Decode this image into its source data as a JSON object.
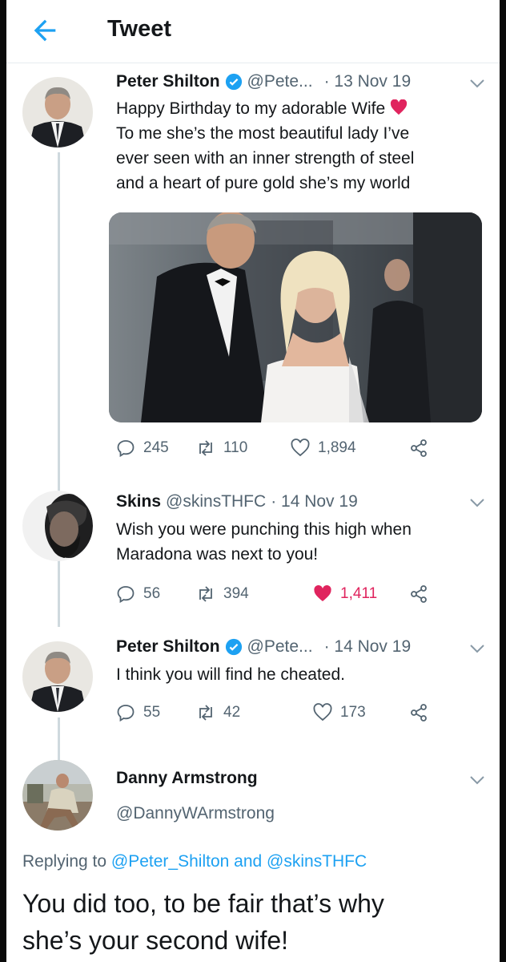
{
  "header": {
    "title": "Tweet"
  },
  "tweet_main": {
    "name": "Peter Shilton",
    "handle": "@Pete...",
    "date": "· 13 Nov 19",
    "text_lines": [
      "Happy Birthday to my adorable Wife",
      "To me she’s the most beautiful lady I’ve",
      "ever seen with an inner strength of steel",
      "and a heart of pure gold she’s my world"
    ],
    "replies": "245",
    "retweets": "110",
    "likes": "1,894"
  },
  "reply_skins": {
    "name": "Skins",
    "handle": "@skinsTHFC",
    "date": "· 14 Nov 19",
    "text_lines": [
      "Wish you were punching this high when",
      "Maradona was next to you!"
    ],
    "replies": "56",
    "retweets": "394",
    "likes": "1,411"
  },
  "reply_shilton": {
    "name": "Peter Shilton",
    "handle": "@Pete...",
    "date": "· 14 Nov 19",
    "text": "I think you will find he cheated.",
    "replies": "55",
    "retweets": "42",
    "likes": "173"
  },
  "focused_reply": {
    "name": "Danny Armstrong",
    "handle": "@DannyWArmstrong",
    "replying_prefix": "Replying to ",
    "replying_user1": "@Peter_Shilton",
    "replying_and": " and ",
    "replying_user2": "@skinsTHFC",
    "text_lines": [
      "You did too, to be fair that’s why",
      "she’s your second wife!"
    ]
  },
  "colors": {
    "accent": "#1da1f2",
    "verified": "#1da1f2",
    "like_active": "#e0245e",
    "secondary_text": "#536471"
  },
  "icons": [
    "back-arrow-icon",
    "verified-badge-icon",
    "chevron-down-icon",
    "reply-icon",
    "retweet-icon",
    "like-icon",
    "share-icon"
  ]
}
